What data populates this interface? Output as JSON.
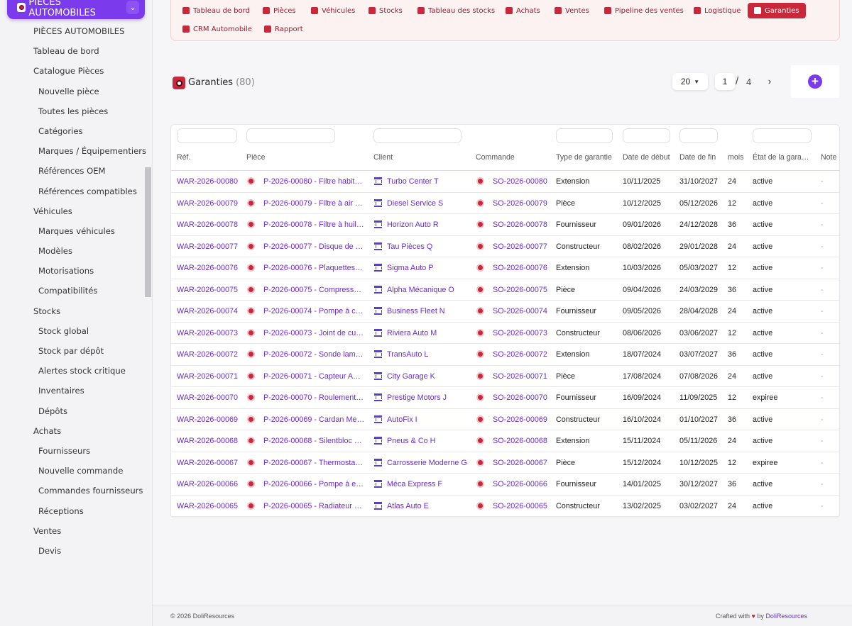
{
  "sidebar": {
    "module_label": "PIÈCES AUTOMOBILES",
    "items": [
      {
        "label": "PIÈCES AUTOMOBILES",
        "level": 0
      },
      {
        "label": "Tableau de bord",
        "level": 0
      },
      {
        "label": "Catalogue Pièces",
        "level": 0
      },
      {
        "label": "Nouvelle pièce",
        "level": 1
      },
      {
        "label": "Toutes les pièces",
        "level": 1
      },
      {
        "label": "Catégories",
        "level": 1
      },
      {
        "label": "Marques / Équipementiers",
        "level": 1
      },
      {
        "label": "Références OEM",
        "level": 1
      },
      {
        "label": "Références compatibles",
        "level": 1
      },
      {
        "label": "Véhicules",
        "level": 0
      },
      {
        "label": "Marques véhicules",
        "level": 1
      },
      {
        "label": "Modèles",
        "level": 1
      },
      {
        "label": "Motorisations",
        "level": 1
      },
      {
        "label": "Compatibilités",
        "level": 1
      },
      {
        "label": "Stocks",
        "level": 0
      },
      {
        "label": "Stock global",
        "level": 1
      },
      {
        "label": "Stock par dépôt",
        "level": 1
      },
      {
        "label": "Alertes stock critique",
        "level": 1
      },
      {
        "label": "Inventaires",
        "level": 1
      },
      {
        "label": "Dépôts",
        "level": 1
      },
      {
        "label": "Achats",
        "level": 0
      },
      {
        "label": "Fournisseurs",
        "level": 1
      },
      {
        "label": "Nouvelle commande",
        "level": 1
      },
      {
        "label": "Commandes fournisseurs",
        "level": 1
      },
      {
        "label": "Réceptions",
        "level": 1
      },
      {
        "label": "Ventes",
        "level": 0
      },
      {
        "label": "Devis",
        "level": 1
      }
    ]
  },
  "topmenu": {
    "items": [
      {
        "label": "Tableau de bord",
        "icon": "gauge-icon",
        "active": false
      },
      {
        "label": "Pièces",
        "icon": "gear-icon",
        "active": false
      },
      {
        "label": "Véhicules",
        "icon": "car-icon",
        "active": false
      },
      {
        "label": "Stocks",
        "icon": "boxes-icon",
        "active": false
      },
      {
        "label": "Tableau des stocks",
        "icon": "grid-icon",
        "active": false
      },
      {
        "label": "Achats",
        "icon": "document-icon",
        "active": false
      },
      {
        "label": "Ventes",
        "icon": "cart-icon",
        "active": false
      },
      {
        "label": "Pipeline des ventes",
        "icon": "list-icon",
        "active": false
      },
      {
        "label": "Logistique",
        "icon": "truck-icon",
        "active": false
      },
      {
        "label": "Garanties",
        "icon": "shield-icon",
        "active": true
      },
      {
        "label": "CRM Automobile",
        "icon": "user-plus-icon",
        "active": false
      },
      {
        "label": "Rapport",
        "icon": "pie-chart-icon",
        "active": false
      }
    ],
    "accent": "#c8283a"
  },
  "list": {
    "title": "Garanties",
    "count": "(80)",
    "page_size": "20",
    "page": "1",
    "page_sep": "/",
    "total_pages": "4",
    "next_icon": "›",
    "add_icon": "+"
  },
  "table": {
    "headers": [
      "Réf.",
      "Pièce",
      "Client",
      "Commande",
      "Type de garantie",
      "Date de début",
      "Date de fin",
      "mois",
      "État de la gara…",
      "Note"
    ],
    "rows": [
      {
        "ref": "WAR-2026-00080",
        "piece": "P-2026-00080 - Filtre habit…",
        "client": "Turbo Center T",
        "order": "SO-2026-00080",
        "type": "Extension",
        "start": "10/11/2025",
        "end": "31/10/2027",
        "months": "24",
        "state": "active",
        "note": "-"
      },
      {
        "ref": "WAR-2026-00079",
        "piece": "P-2026-00079 - Filtre à air …",
        "client": "Diesel Service S",
        "order": "SO-2026-00079",
        "type": "Pièce",
        "start": "10/12/2025",
        "end": "05/12/2026",
        "months": "12",
        "state": "active",
        "note": "-"
      },
      {
        "ref": "WAR-2026-00078",
        "piece": "P-2026-00078 - Filtre à huil…",
        "client": "Horizon Auto R",
        "order": "SO-2026-00078",
        "type": "Fournisseur",
        "start": "09/01/2026",
        "end": "24/12/2028",
        "months": "36",
        "state": "active",
        "note": "-"
      },
      {
        "ref": "WAR-2026-00077",
        "piece": "P-2026-00077 - Disque de …",
        "client": "Tau Pièces Q",
        "order": "SO-2026-00077",
        "type": "Constructeur",
        "start": "08/02/2026",
        "end": "29/01/2028",
        "months": "24",
        "state": "active",
        "note": "-"
      },
      {
        "ref": "WAR-2026-00076",
        "piece": "P-2026-00076 - Plaquettes…",
        "client": "Sigma Auto P",
        "order": "SO-2026-00076",
        "type": "Extension",
        "start": "10/03/2026",
        "end": "05/03/2027",
        "months": "12",
        "state": "active",
        "note": "-"
      },
      {
        "ref": "WAR-2026-00075",
        "piece": "P-2026-00075 - Compress…",
        "client": "Alpha Mécanique O",
        "order": "SO-2026-00075",
        "type": "Pièce",
        "start": "09/04/2026",
        "end": "24/03/2029",
        "months": "36",
        "state": "active",
        "note": "-"
      },
      {
        "ref": "WAR-2026-00074",
        "piece": "P-2026-00074 - Pompe à c…",
        "client": "Business Fleet N",
        "order": "SO-2026-00074",
        "type": "Fournisseur",
        "start": "09/05/2026",
        "end": "28/04/2028",
        "months": "24",
        "state": "active",
        "note": "-"
      },
      {
        "ref": "WAR-2026-00073",
        "piece": "P-2026-00073 - Joint de cu…",
        "client": "Riviera Auto M",
        "order": "SO-2026-00073",
        "type": "Constructeur",
        "start": "08/06/2026",
        "end": "03/06/2027",
        "months": "12",
        "state": "active",
        "note": "-"
      },
      {
        "ref": "WAR-2026-00072",
        "piece": "P-2026-00072 - Sonde lam…",
        "client": "TransAuto L",
        "order": "SO-2026-00072",
        "type": "Extension",
        "start": "18/07/2024",
        "end": "03/07/2027",
        "months": "36",
        "state": "active",
        "note": "-"
      },
      {
        "ref": "WAR-2026-00071",
        "piece": "P-2026-00071 - Capteur A…",
        "client": "City Garage K",
        "order": "SO-2026-00071",
        "type": "Pièce",
        "start": "17/08/2024",
        "end": "07/08/2026",
        "months": "24",
        "state": "active",
        "note": "-"
      },
      {
        "ref": "WAR-2026-00070",
        "piece": "P-2026-00070 - Roulement…",
        "client": "Prestige Motors J",
        "order": "SO-2026-00070",
        "type": "Fournisseur",
        "start": "16/09/2024",
        "end": "11/09/2025",
        "months": "12",
        "state": "expiree",
        "note": "-"
      },
      {
        "ref": "WAR-2026-00069",
        "piece": "P-2026-00069 - Cardan Me…",
        "client": "AutoFix I",
        "order": "SO-2026-00069",
        "type": "Constructeur",
        "start": "16/10/2024",
        "end": "01/10/2027",
        "months": "36",
        "state": "active",
        "note": "-"
      },
      {
        "ref": "WAR-2026-00068",
        "piece": "P-2026-00068 - Silentbloc …",
        "client": "Pneus & Co H",
        "order": "SO-2026-00068",
        "type": "Extension",
        "start": "15/11/2024",
        "end": "05/11/2026",
        "months": "24",
        "state": "active",
        "note": "-"
      },
      {
        "ref": "WAR-2026-00067",
        "piece": "P-2026-00067 - Thermosta…",
        "client": "Carrosserie Moderne G",
        "order": "SO-2026-00067",
        "type": "Pièce",
        "start": "15/12/2024",
        "end": "10/12/2025",
        "months": "12",
        "state": "expiree",
        "note": "-"
      },
      {
        "ref": "WAR-2026-00066",
        "piece": "P-2026-00066 - Pompe à e…",
        "client": "Méca Express F",
        "order": "SO-2026-00066",
        "type": "Fournisseur",
        "start": "14/01/2025",
        "end": "30/12/2027",
        "months": "36",
        "state": "active",
        "note": "-"
      },
      {
        "ref": "WAR-2026-00065",
        "piece": "P-2026-00065 - Radiateur …",
        "client": "Atlas Auto E",
        "order": "SO-2026-00065",
        "type": "Constructeur",
        "start": "13/02/2025",
        "end": "03/02/2027",
        "months": "24",
        "state": "active",
        "note": "-"
      }
    ]
  },
  "footer": {
    "copyright": "© 2026 DoliResources",
    "crafted": "Crafted with",
    "heart": "♥",
    "by": "by",
    "brand": "DoliResources"
  }
}
